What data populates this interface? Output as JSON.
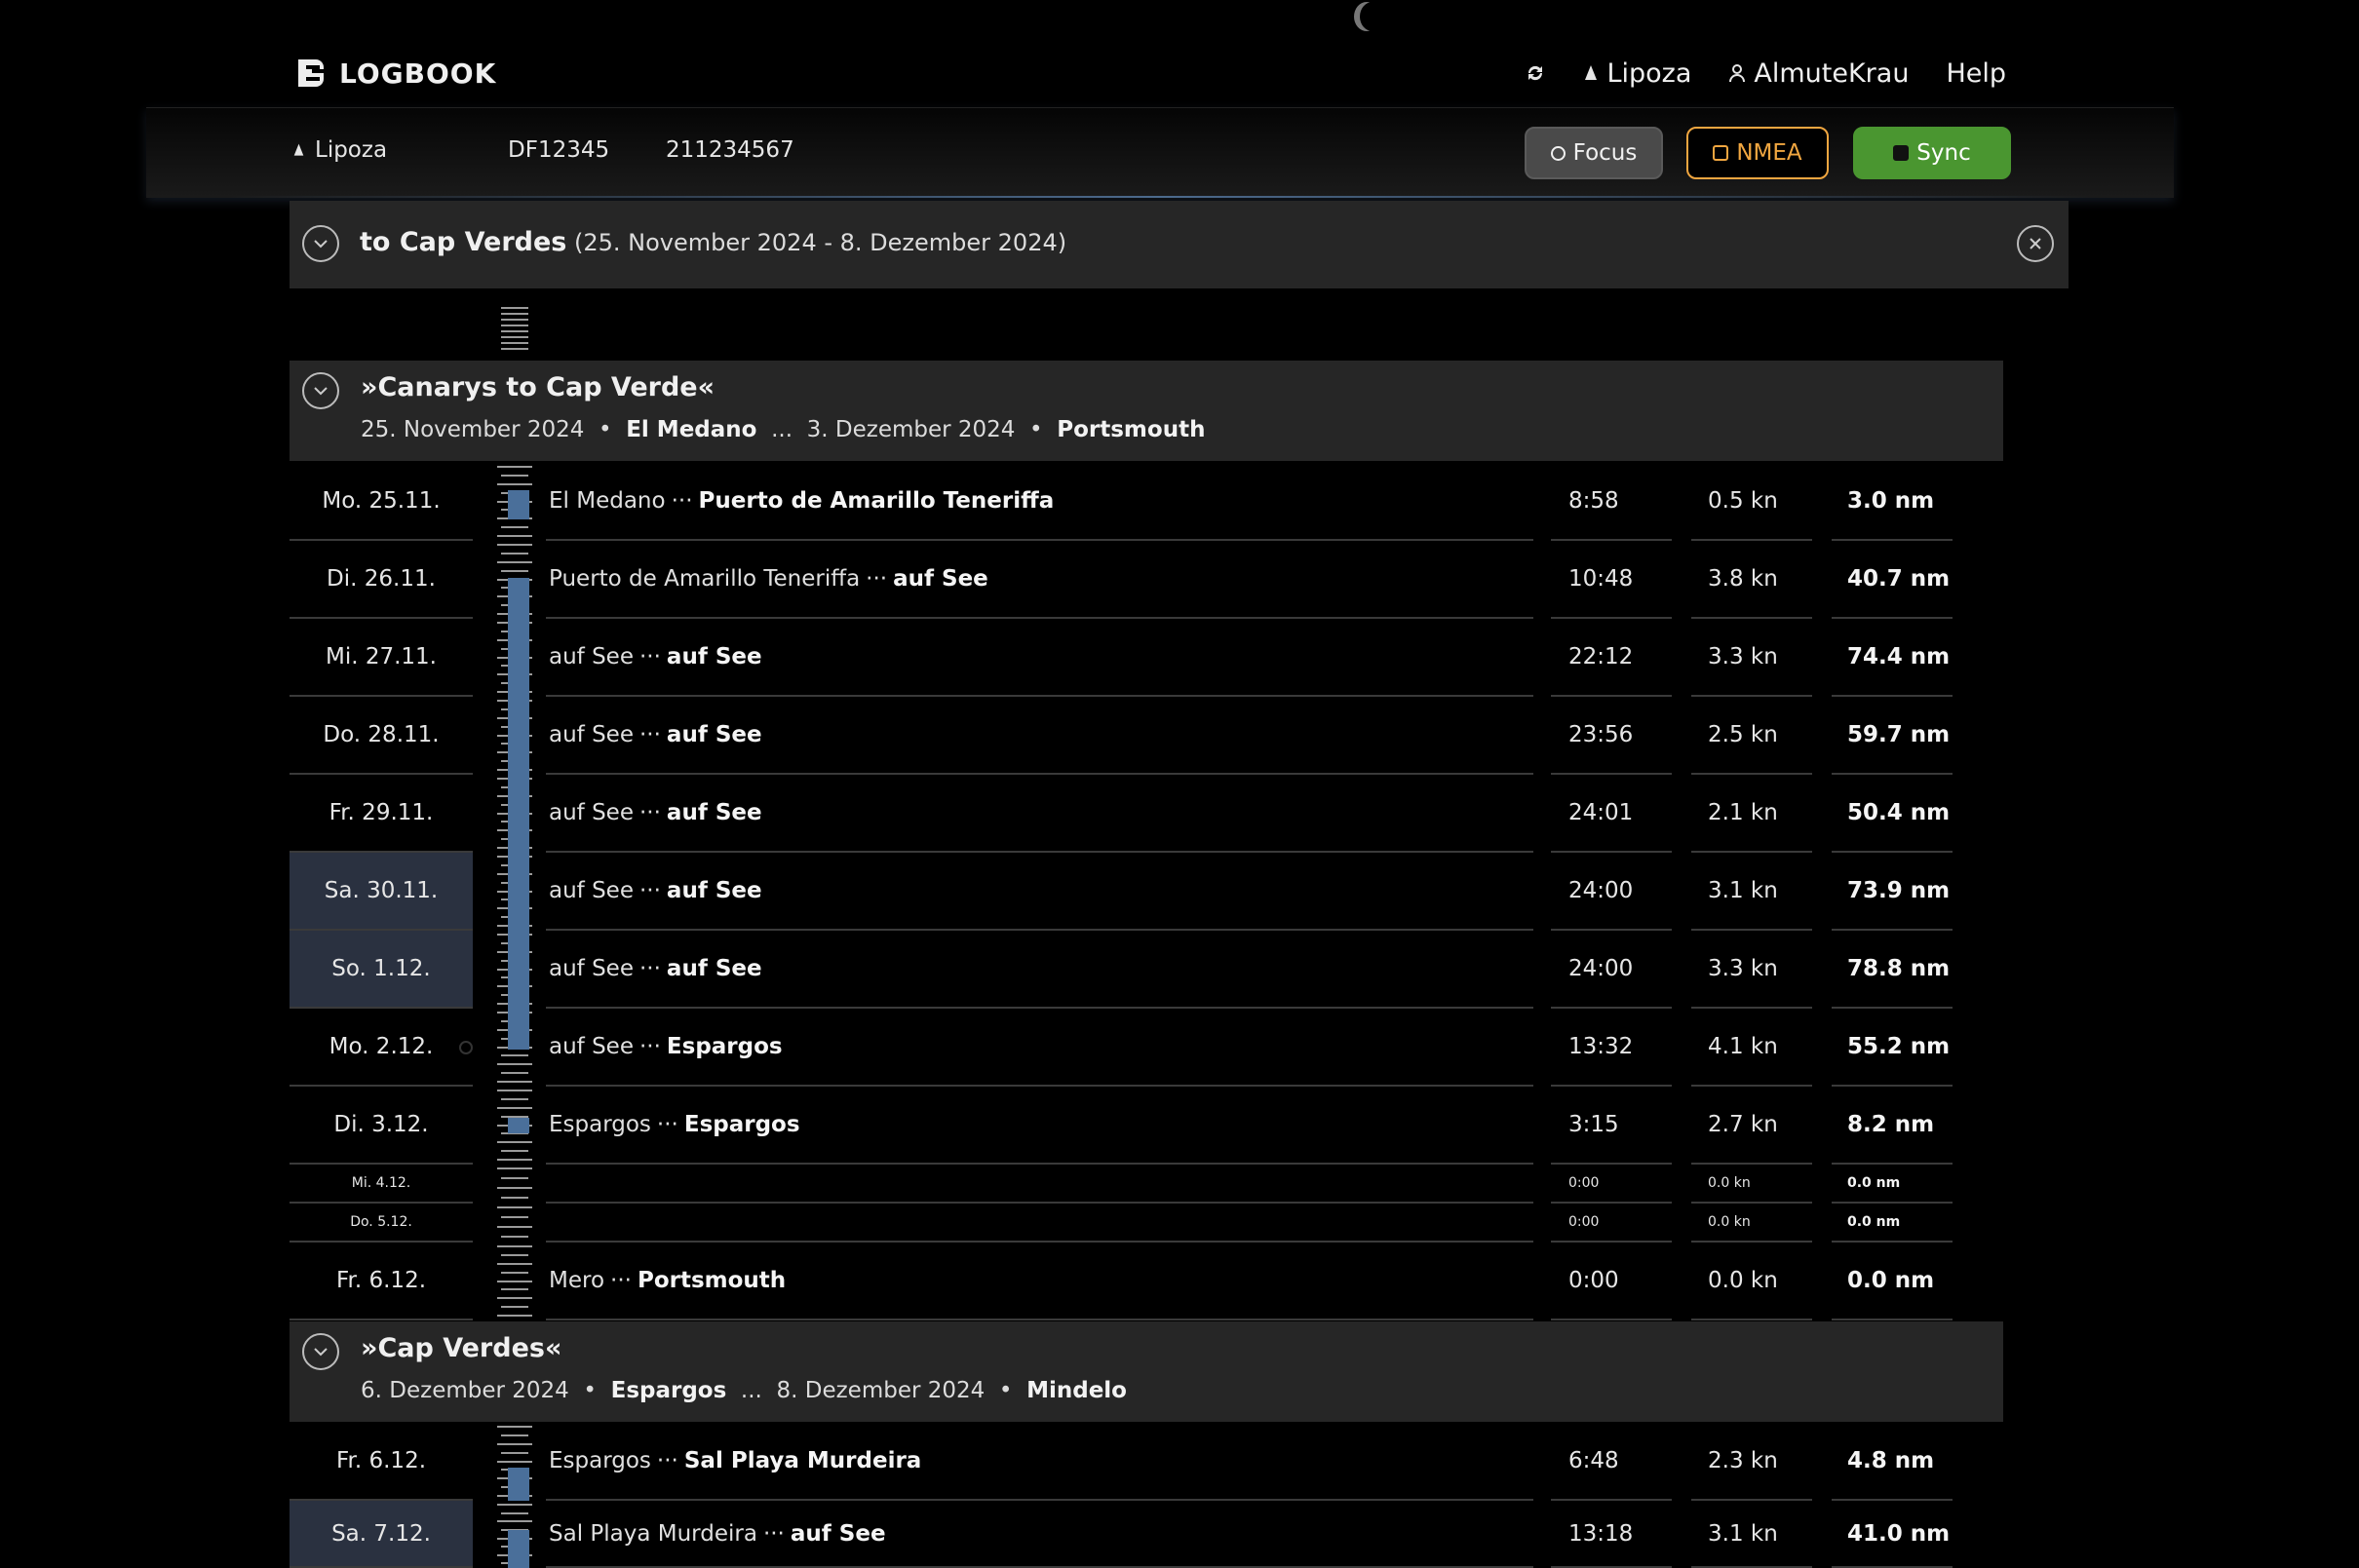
{
  "app": {
    "name": "LOGBOOK"
  },
  "nav": {
    "boat": "Lipoza",
    "user": "AlmuteKrau",
    "help": "Help"
  },
  "subbar": {
    "boat": "Lipoza",
    "callsign": "DF12345",
    "mmsi": "211234567",
    "focus_label": "Focus",
    "nmea_label": "NMEA",
    "sync_label": "Sync"
  },
  "trip": {
    "title": "to Cap Verdes",
    "dates": "(25. November 2024 - 8. Dezember 2024)"
  },
  "segments": [
    {
      "title": "»Canarys to Cap Verde«",
      "start_date": "25. November 2024",
      "start_place": "El Medano",
      "sep": "...",
      "end_date": "3. Dezember 2024",
      "end_place": "Portsmouth",
      "days": [
        {
          "day": "Mo. 25.11.",
          "from": "El Medano",
          "to": "Puerto de Amarillo Teneriffa",
          "time": "8:58",
          "speed": "0.5 kn",
          "dist": "3.0 nm"
        },
        {
          "day": "Di. 26.11.",
          "from": "Puerto de Amarillo Teneriffa",
          "to": "auf See",
          "time": "10:48",
          "speed": "3.8 kn",
          "dist": "40.7 nm"
        },
        {
          "day": "Mi. 27.11.",
          "from": "auf See",
          "to": "auf See",
          "time": "22:12",
          "speed": "3.3 kn",
          "dist": "74.4 nm"
        },
        {
          "day": "Do. 28.11.",
          "from": "auf See",
          "to": "auf See",
          "time": "23:56",
          "speed": "2.5 kn",
          "dist": "59.7 nm"
        },
        {
          "day": "Fr. 29.11.",
          "from": "auf See",
          "to": "auf See",
          "time": "24:01",
          "speed": "2.1 kn",
          "dist": "50.4 nm"
        },
        {
          "day": "Sa. 30.11.",
          "from": "auf See",
          "to": "auf See",
          "time": "24:00",
          "speed": "3.1 kn",
          "dist": "73.9 nm"
        },
        {
          "day": "So. 1.12.",
          "from": "auf See",
          "to": "auf See",
          "time": "24:00",
          "speed": "3.3 kn",
          "dist": "78.8 nm"
        },
        {
          "day": "Mo. 2.12.",
          "from": "auf See",
          "to": "Espargos",
          "time": "13:32",
          "speed": "4.1 kn",
          "dist": "55.2 nm"
        },
        {
          "day": "Di. 3.12.",
          "from": "Espargos",
          "to": "Espargos",
          "time": "3:15",
          "speed": "2.7 kn",
          "dist": "8.2 nm"
        },
        {
          "day": "Mi. 4.12.",
          "from": "",
          "to": "",
          "time": "0:00",
          "speed": "0.0 kn",
          "dist": "0.0 nm"
        },
        {
          "day": "Do. 5.12.",
          "from": "",
          "to": "",
          "time": "0:00",
          "speed": "0.0 kn",
          "dist": "0.0 nm"
        },
        {
          "day": "Fr. 6.12.",
          "from": "Mero",
          "to": "Portsmouth",
          "time": "0:00",
          "speed": "0.0 kn",
          "dist": "0.0 nm"
        }
      ]
    },
    {
      "title": "»Cap Verdes«",
      "start_date": "6. Dezember 2024",
      "start_place": "Espargos",
      "sep": "...",
      "end_date": "8. Dezember 2024",
      "end_place": "Mindelo",
      "days": [
        {
          "day": "Fr. 6.12.",
          "from": "Espargos",
          "to": "Sal Playa Murdeira",
          "time": "6:48",
          "speed": "2.3 kn",
          "dist": "4.8 nm"
        },
        {
          "day": "Sa. 7.12.",
          "from": "Sal Playa Murdeira",
          "to": "auf See",
          "time": "13:18",
          "speed": "3.1 kn",
          "dist": "41.0 nm"
        }
      ]
    }
  ],
  "route_separator": "···",
  "colors": {
    "accent_sync": "#4a9630",
    "accent_nmea": "#f0a640",
    "timeline_bar": "#4a6f9a",
    "highlight_day": "#2a3140"
  },
  "icons": [
    "logo-icon",
    "refresh-icon",
    "sailboat-icon",
    "user-icon",
    "circle-icon",
    "square-icon",
    "chevron-down-icon",
    "close-icon"
  ]
}
